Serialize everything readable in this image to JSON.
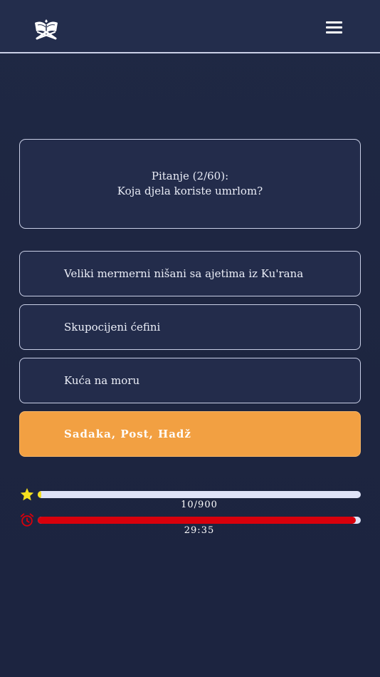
{
  "quiz": {
    "question_label": "Pitanje (2/60):",
    "question_text": "Koja djela koriste umrlom?",
    "answers": [
      {
        "label": "Veliki mermerni nišani sa ajetima iz Ku'rana",
        "selected": false
      },
      {
        "label": "Skupocijeni ćefini",
        "selected": false
      },
      {
        "label": "Kuća na moru",
        "selected": false
      },
      {
        "label": "Sadaka, Post, Hadž",
        "selected": true
      }
    ]
  },
  "score": {
    "icon": "star-icon",
    "text": "10/900",
    "value": 10,
    "max": 900,
    "color": "#f5e01f"
  },
  "timer": {
    "icon": "alarm-clock-icon",
    "text": "29:35",
    "remaining_fraction": 0.985,
    "color": "#d8000c"
  },
  "colors": {
    "background": "#1e2642",
    "header": "#232d4c",
    "card_border": "#c9cfe6",
    "selected_answer": "#f2a042"
  }
}
